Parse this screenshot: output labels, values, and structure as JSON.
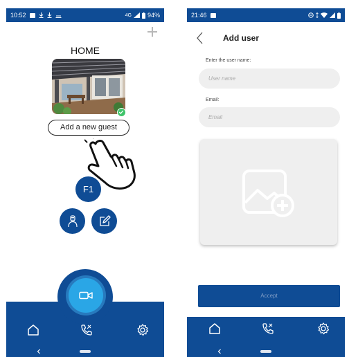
{
  "screen1": {
    "status": {
      "time": "10:52",
      "network": "4G",
      "battery": "94%"
    },
    "home_title": "HOME",
    "add_guest_label": "Add a new guest",
    "floor_badge": "F1",
    "icons": [
      "plus-icon",
      "house-photo",
      "check-icon",
      "pointing-hand-icon",
      "person-icon",
      "edit-icon",
      "video-camera-icon",
      "home-icon",
      "phone-icon",
      "settings-icon"
    ]
  },
  "screen2": {
    "status": {
      "time": "21:46"
    },
    "title": "Add user",
    "name_label": "Enter the user name:",
    "name_placeholder": "User name",
    "email_label": "Email:",
    "email_placeholder": "Email",
    "accept_label": "Accept",
    "icons": [
      "back-chevron-icon",
      "add-image-icon",
      "home-icon",
      "phone-icon",
      "settings-icon"
    ]
  },
  "colors": {
    "primary": "#0f4c95",
    "accent": "#2aa6e6",
    "success": "#3fc46a",
    "field_bg": "#efefef"
  }
}
